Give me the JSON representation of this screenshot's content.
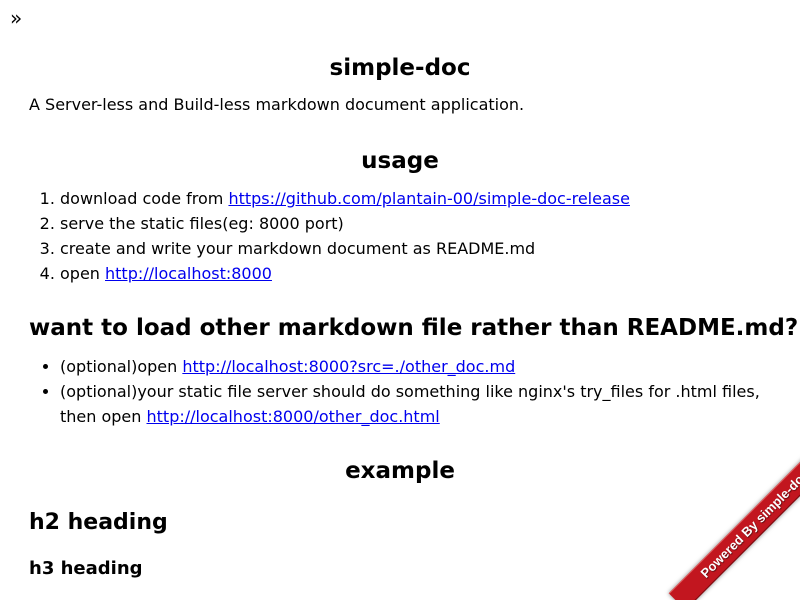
{
  "toggle": {
    "label": "»"
  },
  "doc": {
    "title": "simple-doc",
    "intro": "A Server-less and Build-less markdown document application.",
    "usage": {
      "heading": "usage",
      "steps": [
        {
          "text": "download code from ",
          "link": "https://github.com/plantain-00/simple-doc-release"
        },
        {
          "text": "serve the static files(eg: 8000 port)"
        },
        {
          "text": "create and write your markdown document as README.md"
        },
        {
          "text": "open ",
          "link": "http://localhost:8000"
        }
      ]
    },
    "other": {
      "heading": "want to load other markdown file rather than README.md?",
      "items": [
        {
          "text": "(optional)open ",
          "link": "http://localhost:8000?src=./other_doc.md"
        },
        {
          "text": "(optional)your static file server should do something like nginx's try_files for .html files, then open ",
          "link": "http://localhost:8000/other_doc.html"
        }
      ]
    },
    "example": {
      "heading": "example",
      "h2": "h2 heading",
      "h3": "h3 heading"
    }
  },
  "ribbon": {
    "label": "Powered By simple-doc",
    "color": "#c2161f"
  }
}
